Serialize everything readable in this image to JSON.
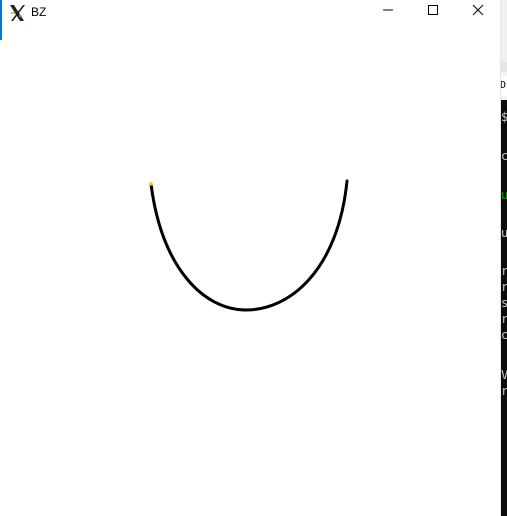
{
  "window": {
    "title": "BZ",
    "icon": "x11-logo-icon",
    "controls": [
      "minimize-icon",
      "maximize-icon",
      "close-icon"
    ]
  },
  "canvas": {
    "curve_color": "#000000",
    "start_marker_color": "#f5c400",
    "background": "#ffffff"
  },
  "background_terminal": {
    "tab_text": "D",
    "lines": [
      "$",
      "c",
      "u",
      "u",
      "r",
      "r",
      "s",
      "r",
      "c",
      "V",
      "r"
    ]
  }
}
